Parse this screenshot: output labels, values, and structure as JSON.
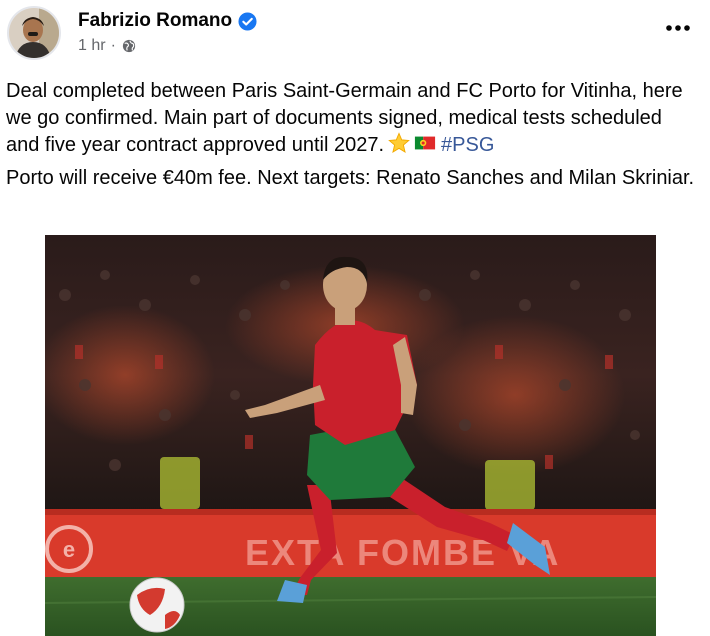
{
  "post": {
    "author": "Fabrizio Romano",
    "time": "1 hr",
    "dot": "·",
    "paragraph1": "Deal completed between Paris Saint-Germain and FC Porto for Vitinha, here we go confirmed. Main part of documents signed, medical tests scheduled and five year contract approved until 2027.",
    "hashtag": "#PSG",
    "paragraph2": "Porto will receive €40m fee. Next targets: Renato Sanches and Milan Skriniar.",
    "emoji_icons": [
      "star-icon",
      "portugal-flag-icon"
    ]
  },
  "photo": {
    "board_text": "EXTA FOMBE  VA",
    "board_logo": "e"
  },
  "colors": {
    "verified": "#1877f2",
    "hashtag": "#385898",
    "meta": "#65676b"
  }
}
